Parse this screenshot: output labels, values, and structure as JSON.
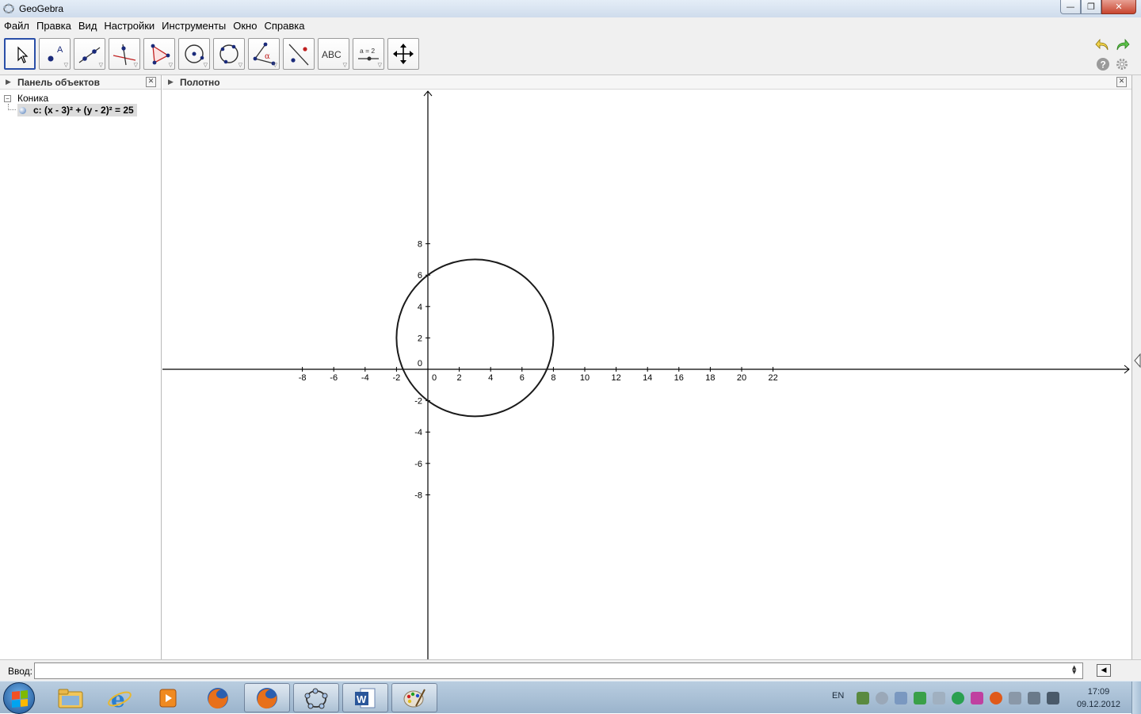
{
  "window": {
    "title": "GeoGebra"
  },
  "menu": [
    "Файл",
    "Правка",
    "Вид",
    "Настройки",
    "Инструменты",
    "Окно",
    "Справка"
  ],
  "toolbar": {
    "tools": [
      {
        "name": "move-tool-button",
        "icon": "arrow-cursor-icon",
        "active": true
      },
      {
        "name": "point-tool-button",
        "icon": "point-icon",
        "label": "A"
      },
      {
        "name": "line-tool-button",
        "icon": "line-through-points-icon"
      },
      {
        "name": "perpendicular-tool-button",
        "icon": "perpendicular-line-icon"
      },
      {
        "name": "polygon-tool-button",
        "icon": "polygon-icon"
      },
      {
        "name": "circle-tool-button",
        "icon": "circle-center-point-icon"
      },
      {
        "name": "conic-tool-button",
        "icon": "conic-five-points-icon"
      },
      {
        "name": "angle-tool-button",
        "icon": "angle-icon",
        "label": "α"
      },
      {
        "name": "reflect-tool-button",
        "icon": "reflect-about-line-icon"
      },
      {
        "name": "text-tool-button",
        "icon": "text-icon",
        "label": "ABC"
      },
      {
        "name": "slider-tool-button",
        "icon": "slider-icon",
        "label": "a = 2"
      },
      {
        "name": "move-graphics-tool-button",
        "icon": "move-graphics-view-icon"
      }
    ]
  },
  "algebra": {
    "title": "Панель объектов",
    "group": "Коника",
    "object": "c: (x - 3)² + (y - 2)² = 25"
  },
  "graphics": {
    "title": "Полотно",
    "x_ticks": [
      "-8",
      "-6",
      "-4",
      "-2",
      "2",
      "4",
      "6",
      "8",
      "10",
      "12",
      "14",
      "16",
      "18",
      "20",
      "22"
    ],
    "y_ticks": [
      "8",
      "6",
      "4",
      "2",
      "-2",
      "-4",
      "-6",
      "-8"
    ],
    "origin_label": "0",
    "circle": {
      "cx": 3,
      "cy": 2,
      "r": 5,
      "color": "#1a1a1a"
    }
  },
  "input": {
    "label": "Ввод:",
    "value": ""
  },
  "tray": {
    "lang": "EN",
    "time": "17:09",
    "date": "09.12.2012"
  },
  "colors": {
    "accent": "#2a4fa8",
    "axis": "#000000"
  }
}
